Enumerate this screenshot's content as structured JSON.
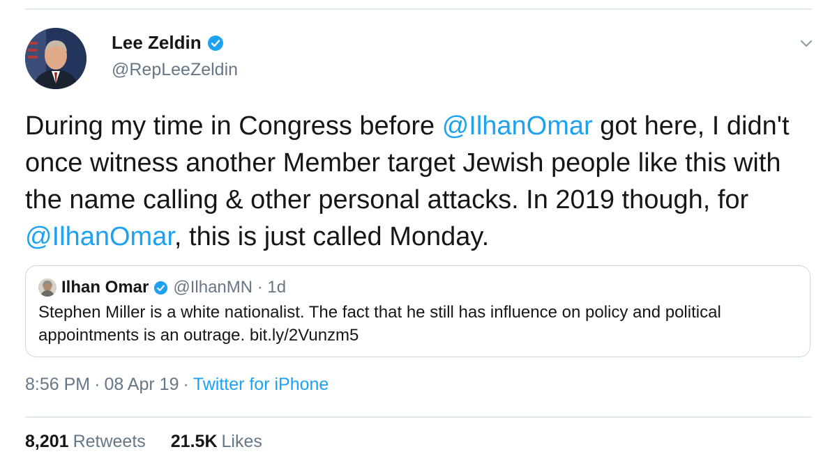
{
  "author": {
    "display_name": "Lee Zeldin",
    "handle": "@RepLeeZeldin",
    "avatar_icon": "profile-photo",
    "verified_icon": "verified-badge-icon"
  },
  "tweet": {
    "segments": [
      {
        "text": "During my time in Congress before ",
        "mention": false
      },
      {
        "text": "@IlhanOmar",
        "mention": true
      },
      {
        "text": " got here, I didn't once witness another Member target Jewish people like this with the name calling & other personal attacks. In 2019 though, for ",
        "mention": false
      },
      {
        "text": "@IlhanOmar",
        "mention": true
      },
      {
        "text": ", this is just called Monday.",
        "mention": false
      }
    ]
  },
  "quoted_tweet": {
    "display_name": "Ilhan Omar",
    "handle_time": "@IlhanMN · 1d",
    "text": "Stephen Miller is a white nationalist. The fact that he still has influence on policy and political appointments is an outrage. bit.ly/2Vunzm5"
  },
  "meta": {
    "time": "8:56 PM",
    "sep1": "·",
    "date": "08 Apr 19",
    "sep2": "·",
    "source": "Twitter for iPhone"
  },
  "stats": {
    "retweets_count": "8,201",
    "retweets_label": "Retweets",
    "likes_count": "21.5K",
    "likes_label": "Likes"
  },
  "colors": {
    "link": "#1da1f2",
    "secondary_text": "#657786",
    "primary_text": "#14171a",
    "border": "#ccd6dd"
  }
}
